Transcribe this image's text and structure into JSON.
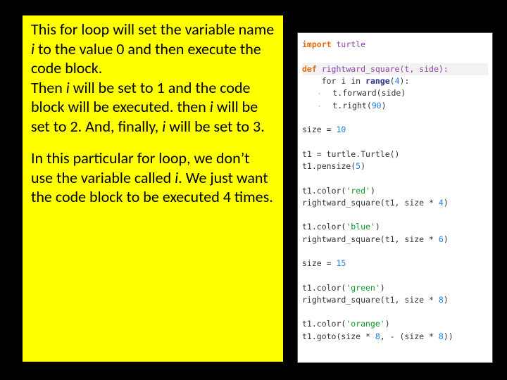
{
  "explain": {
    "p1a": "This for loop will set the variable name ",
    "p1_i1": "i",
    "p1b": " to the value 0 and then execute the code block.",
    "p1c": "Then ",
    "p1_i2": "i",
    "p1d": " will be set to 1 and the code block will be executed. then ",
    "p1_i3": "i",
    "p1e": " will be set to 2. And, finally, ",
    "p1_i4": "i",
    "p1f": " will be set to 3.",
    "p2a": "In this particular for loop, we don’t use the variable called ",
    "p2_i": "i",
    "p2b": ". We just want the code block to be executed 4 times."
  },
  "code": {
    "l1_kw": "import",
    "l1_mod": " turtle",
    "l3_def": "def",
    "l3_name": " rightward_square(t, side):",
    "l4a": "    for ",
    "l4_i": "i",
    "l4b": " in ",
    "l4_range": "range",
    "l4c": "(",
    "l4_n": "4",
    "l4d": "):",
    "l5a": "        t.forward(side)",
    "l6a": "        t.right(",
    "l6_n": "90",
    "l6b": ")",
    "l8a": "size = ",
    "l8_n": "10",
    "l10a": "t1 = turtle.Turtle()",
    "l11a": "t1.pensize(",
    "l11_n": "5",
    "l11b": ")",
    "l13a": "t1.color(",
    "l13_s": "'red'",
    "l13b": ")",
    "l14a": "rightward_square(t1, size * ",
    "l14_n": "4",
    "l14b": ")",
    "l16a": "t1.color(",
    "l16_s": "'blue'",
    "l16b": ")",
    "l17a": "rightward_square(t1, size * ",
    "l17_n": "6",
    "l17b": ")",
    "l19a": "size = ",
    "l19_n": "15",
    "l21a": "t1.color(",
    "l21_s": "'green'",
    "l21b": ")",
    "l22a": "rightward_square(t1, size * ",
    "l22_n": "8",
    "l22b": ")",
    "l24a": "t1.color(",
    "l24_s": "'orange'",
    "l24b": ")",
    "l25a": "t1.goto(size * ",
    "l25_n1": "8",
    "l25b": ", - (size * ",
    "l25_n2": "8",
    "l25c": "))"
  }
}
